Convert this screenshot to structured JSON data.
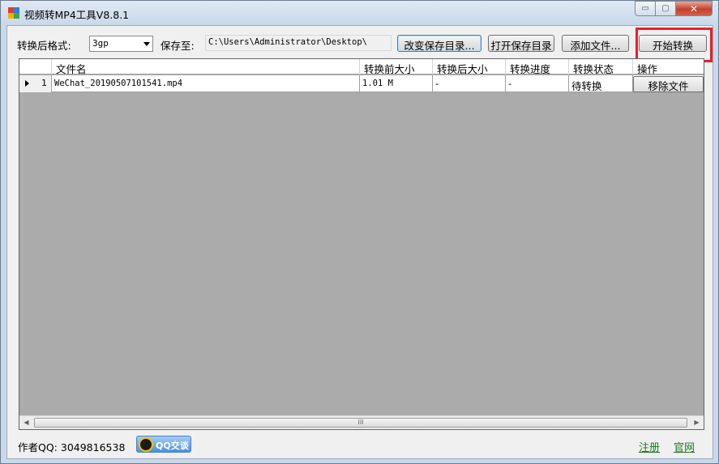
{
  "window": {
    "title": "视频转MP4工具V8.8.1",
    "minimize_glyph": "▭",
    "maximize_glyph": "▢",
    "close_glyph": "✕"
  },
  "toolbar": {
    "format_label": "转换后格式:",
    "format_value": "3gp",
    "save_to_label": "保存至:",
    "save_path": "C:\\Users\\Administrator\\Desktop\\",
    "change_dir_button": "改变保存目录...",
    "open_dir_button": "打开保存目录",
    "add_file_button": "添加文件...",
    "start_button": "开始转换"
  },
  "grid": {
    "columns": [
      "文件名",
      "转换前大小",
      "转换后大小",
      "转换进度",
      "转换状态",
      "操作"
    ],
    "rows": [
      {
        "index": "1",
        "filename": "WeChat_20190507101541.mp4",
        "size_before": "1.01 M",
        "size_after": "-",
        "progress": "-",
        "status": "待转换",
        "action": "移除文件"
      }
    ],
    "scroll_grip": "III"
  },
  "footer": {
    "author_qq": "作者QQ: 3049816538",
    "qq_chat_label": "QQ交谈",
    "register_link": "注册",
    "website_link": "官网"
  },
  "colors": {
    "highlight": "#e8202a",
    "grid_background": "#ababab",
    "link": "#1a7a1a"
  }
}
